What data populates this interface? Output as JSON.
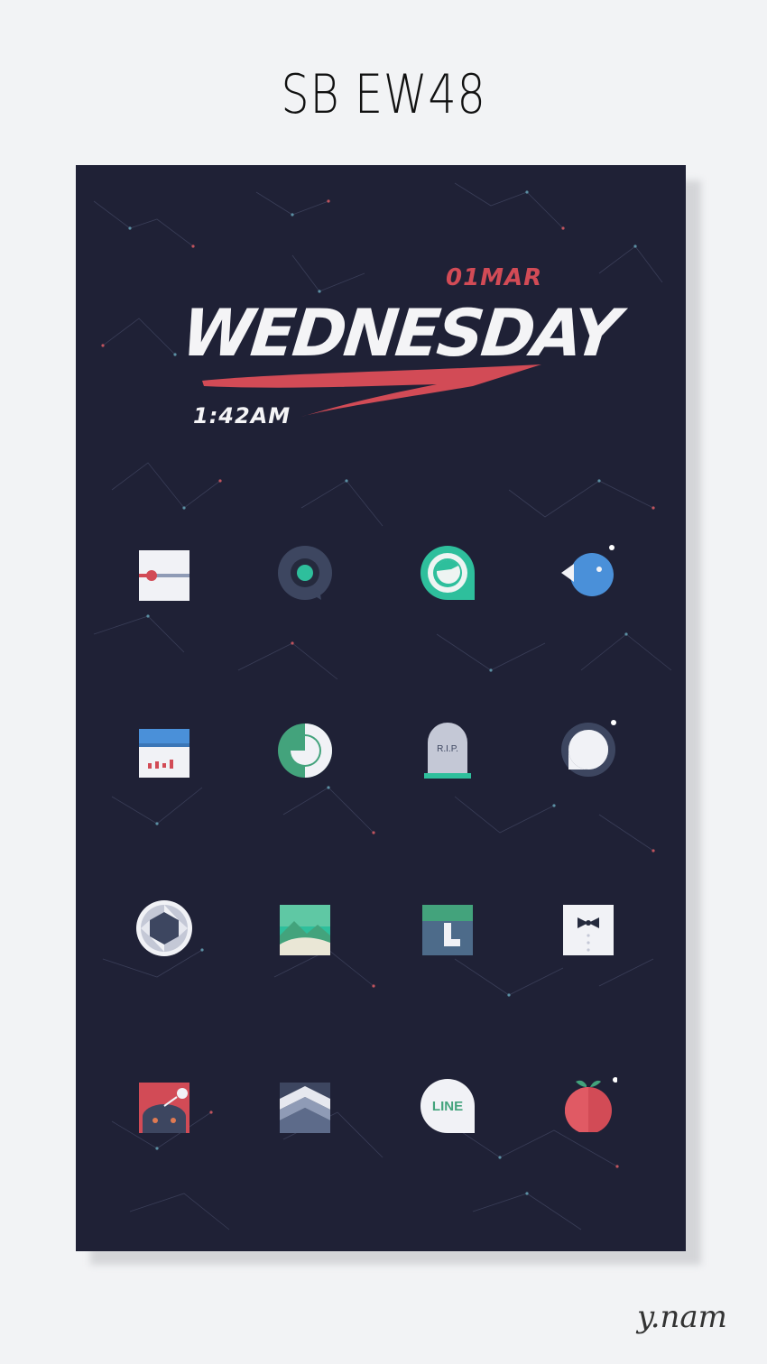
{
  "header": {
    "title": "SB EW48"
  },
  "widget": {
    "date": "01MAR",
    "weekday": "WEDNESDAY",
    "time": "1:42AM"
  },
  "colors": {
    "background": "#1f2136",
    "accent_red": "#d24b56",
    "teal": "#2ebf9c",
    "blue": "#4a90d9"
  },
  "icons": [
    {
      "name": "slider-icon"
    },
    {
      "name": "camera-chat-icon"
    },
    {
      "name": "teal-chat-icon"
    },
    {
      "name": "bird-icon"
    },
    {
      "name": "calendar-icon"
    },
    {
      "name": "green-ring-icon"
    },
    {
      "name": "tombstone-icon",
      "text": "R.I.P."
    },
    {
      "name": "chat-bubble-icon"
    },
    {
      "name": "aperture-icon"
    },
    {
      "name": "landscape-photo-icon"
    },
    {
      "name": "green-download-icon"
    },
    {
      "name": "bowtie-icon"
    },
    {
      "name": "reddit-alien-icon"
    },
    {
      "name": "mountain-layers-icon"
    },
    {
      "name": "line-messenger-icon",
      "text": "LINE"
    },
    {
      "name": "apple-icon"
    }
  ],
  "footer": {
    "signature": "y.nam"
  }
}
